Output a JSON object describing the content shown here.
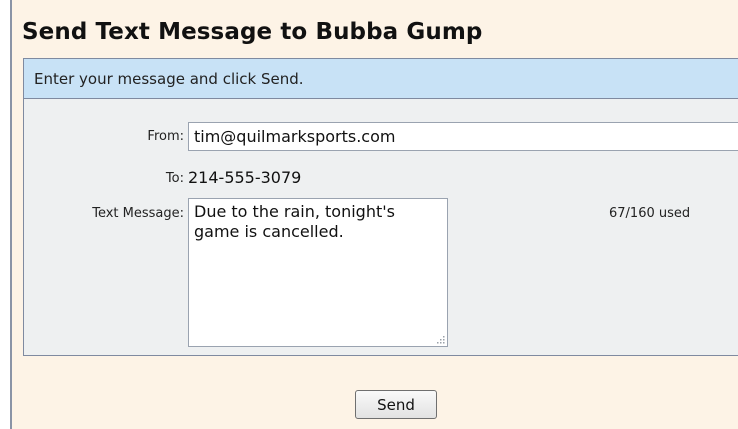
{
  "header": {
    "title": "Send Text Message to Bubba Gump"
  },
  "form": {
    "instructions": "Enter your message and click Send.",
    "from_label": "From:",
    "from_value": "tim@quilmarksports.com",
    "to_label": "To:",
    "to_value": "214-555-3079",
    "message_label": "Text Message:",
    "message_value": "Due to the rain, tonight's game is cancelled.",
    "char_count": "67/160 used"
  },
  "actions": {
    "send_label": "Send"
  },
  "icons": {
    "resize_grip": "resize-grip-icon"
  },
  "colors": {
    "panel_background": "#fdf3e6",
    "instructions_background": "#c8e2f6",
    "form_background": "#eef0f1",
    "border": "#7f8aa0"
  }
}
